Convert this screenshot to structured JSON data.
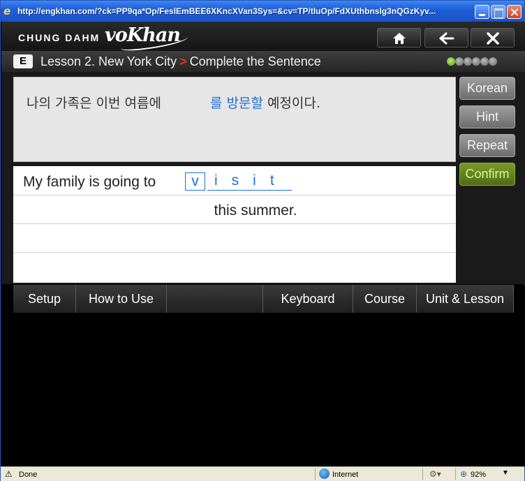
{
  "browser": {
    "url": "http://engkhan.com/?ck=PP9qa*Op/FeslEmBEE6XKncXVan3Sys=&cv=TP/tluOp/FdXUthbnslg3nQGzKyv...",
    "status_text": "Done",
    "zone_text": "Internet",
    "zoom_text": "92%"
  },
  "header": {
    "brand": "CHUNG DAHM",
    "logo": "voKhan",
    "buttons": {
      "home": "home-icon",
      "back": "arrow-left-icon",
      "close": "close-icon"
    }
  },
  "lesson": {
    "badge": "E",
    "title": "Lesson 2. New York City",
    "separator": ">",
    "section": "Complete the Sentence",
    "progress_total": 6,
    "progress_current": 1
  },
  "exercise": {
    "korean_before": "나의 가족은 이번 여름에",
    "korean_target": "를 방문할",
    "korean_after": "예정이다.",
    "english_before": "My family is going to",
    "answer_typed": "v",
    "answer_remaining": "isit",
    "english_after": "this summer."
  },
  "side_buttons": {
    "korean": "Korean",
    "hint": "Hint",
    "repeat": "Repeat",
    "confirm": "Confirm"
  },
  "menu": [
    "Setup",
    "How to Use",
    "",
    "Keyboard",
    "Course",
    "Unit & Lesson"
  ],
  "colors": {
    "accent_blue": "#1f6fd6",
    "confirm_green": "#5e7d1c",
    "progress_active": "#7cc22e",
    "arrow_red": "#e8331a"
  }
}
